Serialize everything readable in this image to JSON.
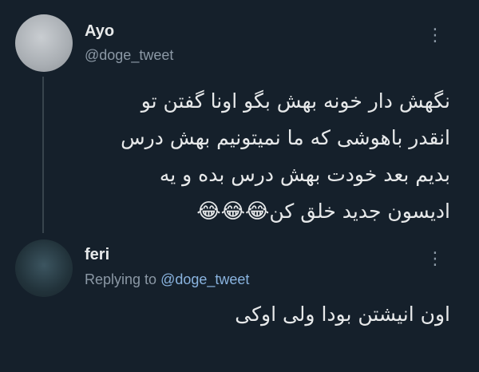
{
  "tweet": {
    "author_name": "Ayo",
    "author_handle": "@doge_tweet",
    "text_lines": [
      "نگهش دار خونه بهش بگو اونا گفتن تو",
      "انقدر باهوشی که ما نمیتونیم بهش درس",
      "بدیم بعد خودت بهش درس بده و یه",
      "ادیسون جدید خلق کن"
    ],
    "emojis": "😂😂😂"
  },
  "reply": {
    "author_name": "feri",
    "replying_prefix": "Replying to",
    "replying_to": "@doge_tweet",
    "text": "اون انیشتن بودا ولی اوکی"
  },
  "icons": {
    "more": "more-vertical-icon"
  },
  "colors": {
    "background": "#15202b",
    "text": "#e7e9ea",
    "secondary": "#8b98a5",
    "mention": "#8ab4e0"
  }
}
